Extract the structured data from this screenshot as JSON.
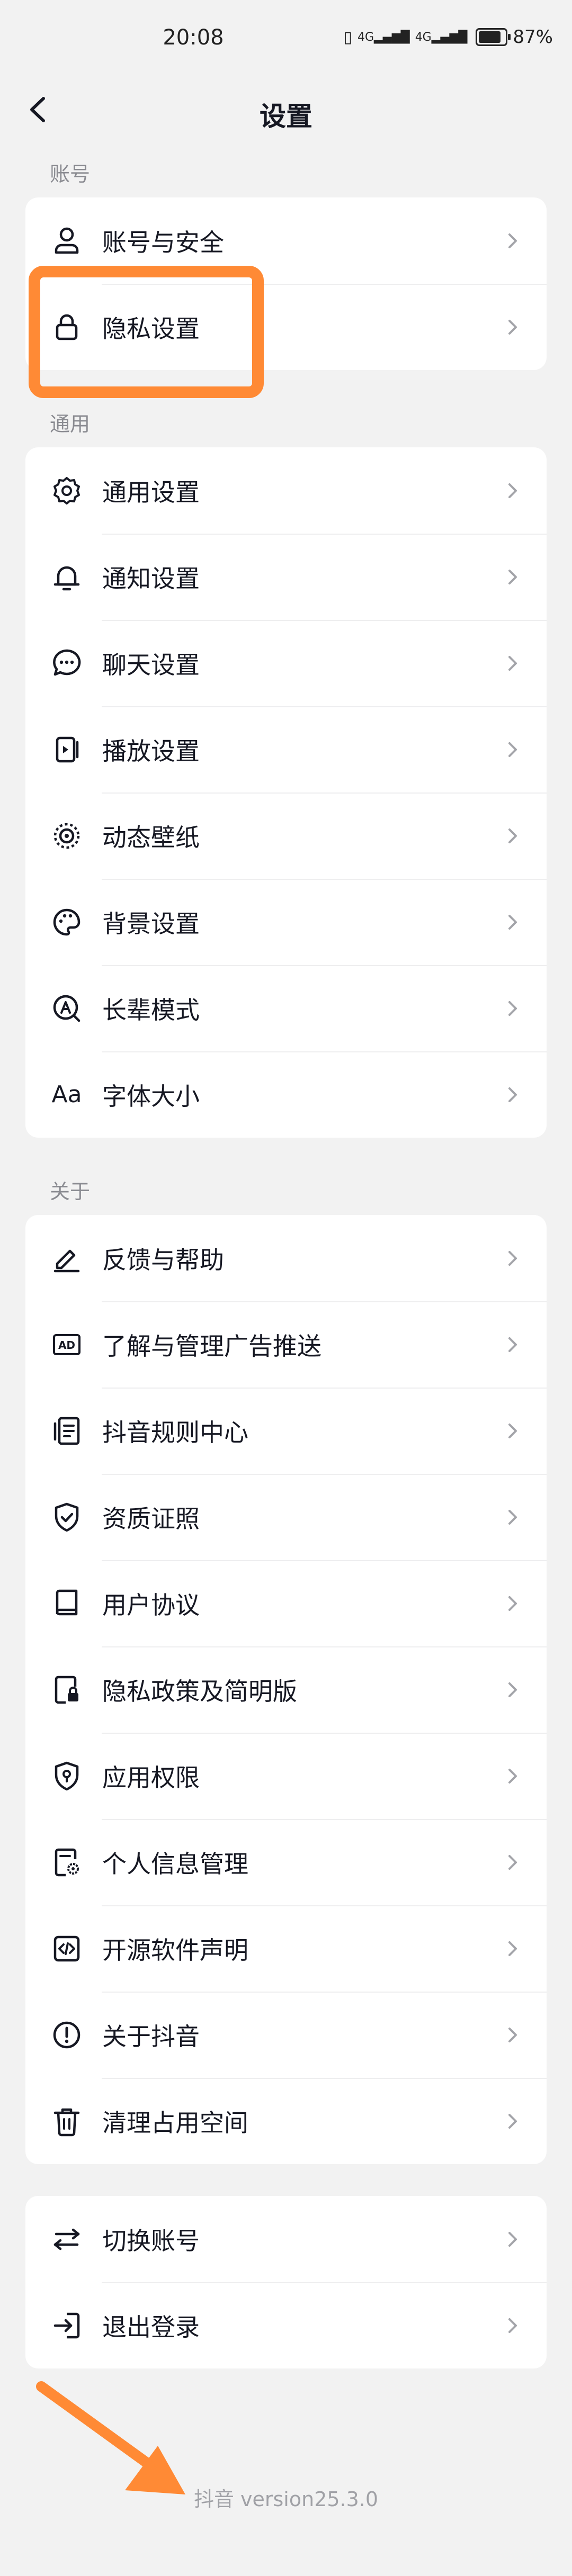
{
  "status_bar": {
    "time": "20:08",
    "network_label_1": "4G",
    "network_label_2": "4G",
    "battery_percent": "87%",
    "battery_level": 0.87
  },
  "header": {
    "title": "设置",
    "back_icon": "chevron-left-icon"
  },
  "sections": {
    "account": {
      "title": "账号",
      "items": [
        {
          "label": "账号与安全",
          "icon": "person-icon"
        },
        {
          "label": "隐私设置",
          "icon": "lock-icon"
        }
      ]
    },
    "general": {
      "title": "通用",
      "items": [
        {
          "label": "通用设置",
          "icon": "gear-icon"
        },
        {
          "label": "通知设置",
          "icon": "bell-icon"
        },
        {
          "label": "聊天设置",
          "icon": "chat-bubble-icon"
        },
        {
          "label": "播放设置",
          "icon": "play-device-icon"
        },
        {
          "label": "动态壁纸",
          "icon": "dynamic-wallpaper-icon"
        },
        {
          "label": "背景设置",
          "icon": "palette-icon"
        },
        {
          "label": "长辈模式",
          "icon": "elder-mode-icon"
        },
        {
          "label": "字体大小",
          "icon": "font-size-icon",
          "glyph": "Aa"
        }
      ]
    },
    "about": {
      "title": "关于",
      "items": [
        {
          "label": "反馈与帮助",
          "icon": "pencil-icon"
        },
        {
          "label": "了解与管理广告推送",
          "icon": "ad-icon",
          "glyph": "AD"
        },
        {
          "label": "抖音规则中心",
          "icon": "rules-document-icon"
        },
        {
          "label": "资质证照",
          "icon": "shield-check-icon"
        },
        {
          "label": "用户协议",
          "icon": "book-icon"
        },
        {
          "label": "隐私政策及简明版",
          "icon": "document-lock-icon"
        },
        {
          "label": "应用权限",
          "icon": "shield-location-icon"
        },
        {
          "label": "个人信息管理",
          "icon": "document-gear-icon"
        },
        {
          "label": "开源软件声明",
          "icon": "code-icon"
        },
        {
          "label": "关于抖音",
          "icon": "info-circle-icon"
        },
        {
          "label": "清理占用空间",
          "icon": "trash-icon"
        }
      ]
    },
    "session": {
      "items": [
        {
          "label": "切换账号",
          "icon": "switch-arrows-icon"
        },
        {
          "label": "退出登录",
          "icon": "logout-icon"
        }
      ]
    }
  },
  "footer": {
    "version": "抖音 version25.3.0"
  },
  "colors": {
    "background": "#f2f2f2",
    "card": "#ffffff",
    "text": "#161823",
    "secondary_text": "#8a8b91",
    "chevron": "#a3a4a9",
    "annotation": "#ff8a35"
  }
}
